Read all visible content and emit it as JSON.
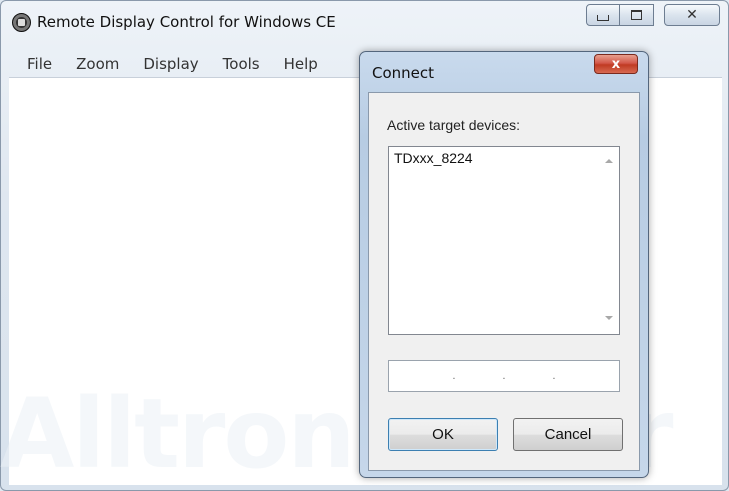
{
  "window": {
    "title": "Remote Display Control for Windows CE",
    "minimize_label": "",
    "maximize_label": "",
    "close_label": "✕"
  },
  "menu": [
    "File",
    "Zoom",
    "Display",
    "Tools",
    "Help"
  ],
  "watermark": "AlltronicsPer",
  "dialog": {
    "title": "Connect",
    "close_label": "x",
    "label": "Active target devices:",
    "devices": [
      "TDxxx_8224"
    ],
    "ip_separators": [
      ".",
      ".",
      "."
    ],
    "ok_label": "OK",
    "cancel_label": "Cancel"
  }
}
